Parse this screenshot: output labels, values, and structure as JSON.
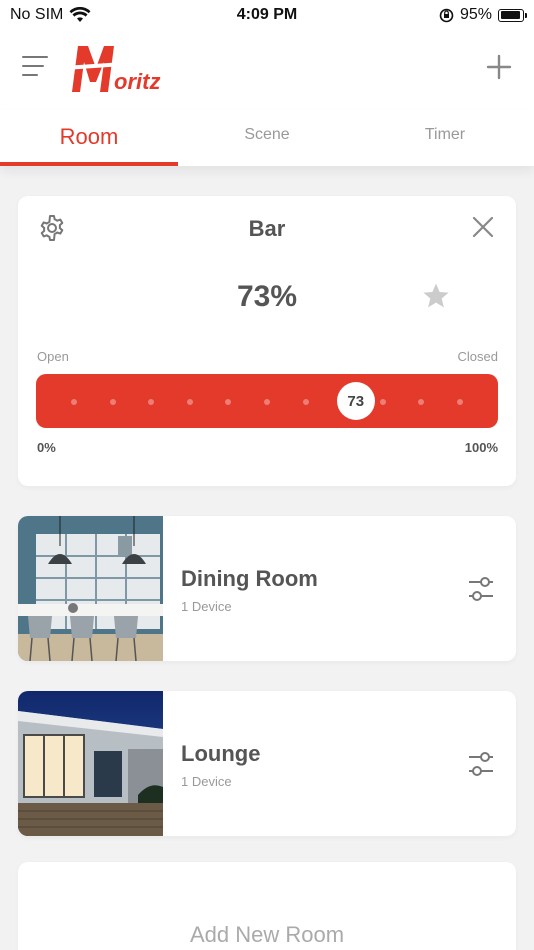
{
  "status": {
    "carrier": "No SIM",
    "time": "4:09 PM",
    "battery": "95%",
    "battery_level": 0.95
  },
  "header": {
    "menu_icon": "menu-icon",
    "logo_text": "oritz",
    "logo_letter": "M",
    "add_icon": "plus-icon"
  },
  "tabs": [
    {
      "label": "Room",
      "active": true
    },
    {
      "label": "Scene",
      "active": false
    },
    {
      "label": "Timer",
      "active": false
    }
  ],
  "bar_card": {
    "title": "Bar",
    "percent_label": "73%",
    "value": 73,
    "open_label": "Open",
    "closed_label": "Closed",
    "min_label": "0%",
    "max_label": "100%",
    "knob_label": "73"
  },
  "rooms": [
    {
      "name": "Dining Room",
      "devices": "1 Device"
    },
    {
      "name": "Lounge",
      "devices": "1 Device"
    }
  ],
  "add_room": {
    "label": "Add New Room"
  },
  "colors": {
    "accent": "#e33a2b",
    "background": "#f2f2f2",
    "card": "#ffffff"
  }
}
